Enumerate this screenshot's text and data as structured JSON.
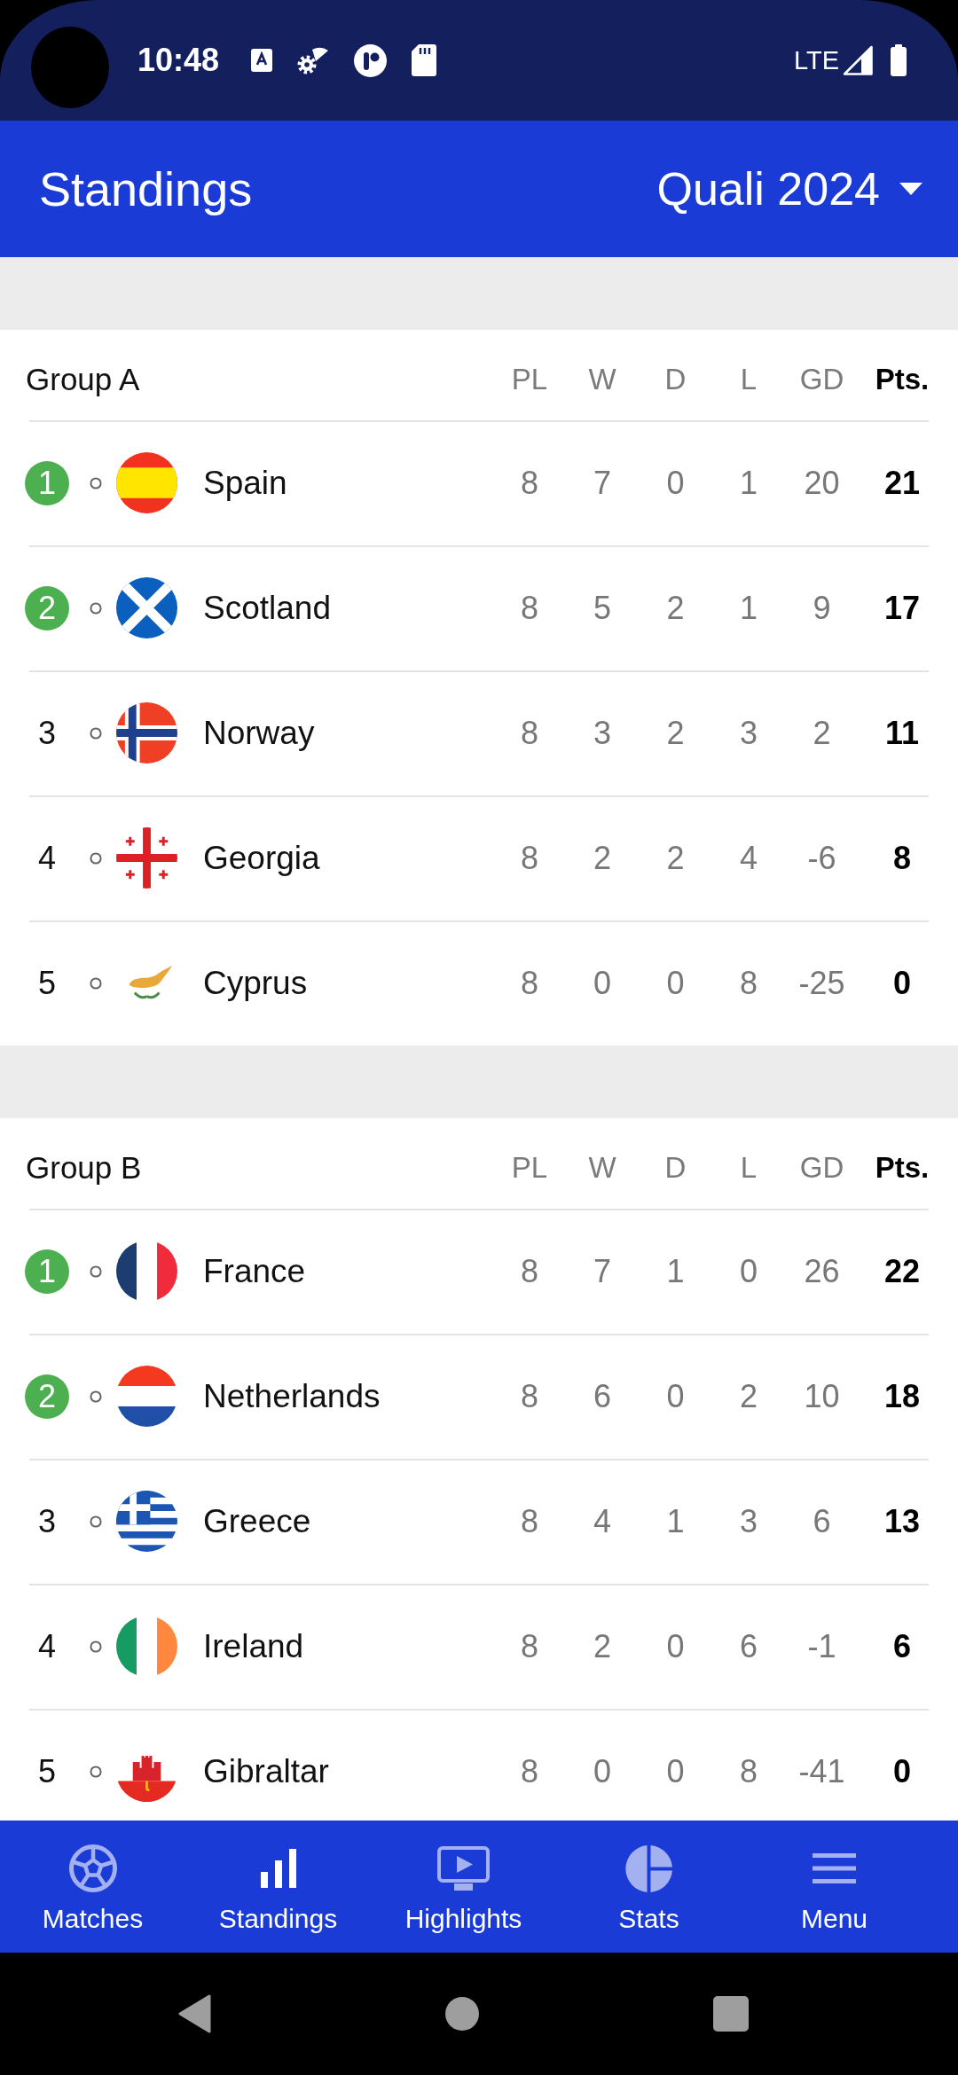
{
  "status_bar": {
    "time": "10:48",
    "network": "LTE"
  },
  "app_bar": {
    "title": "Standings",
    "season": "Quali 2024"
  },
  "groups": [
    {
      "name": "Group A",
      "columns": [
        "PL",
        "W",
        "D",
        "L",
        "GD",
        "Pts."
      ],
      "rows": [
        {
          "rank": "1",
          "qualified": true,
          "team": "Spain",
          "stats": [
            "8",
            "7",
            "0",
            "1",
            "20"
          ],
          "points": "21"
        },
        {
          "rank": "2",
          "qualified": true,
          "team": "Scotland",
          "stats": [
            "8",
            "5",
            "2",
            "1",
            "9"
          ],
          "points": "17"
        },
        {
          "rank": "3",
          "qualified": false,
          "team": "Norway",
          "stats": [
            "8",
            "3",
            "2",
            "3",
            "2"
          ],
          "points": "11"
        },
        {
          "rank": "4",
          "qualified": false,
          "team": "Georgia",
          "stats": [
            "8",
            "2",
            "2",
            "4",
            "-6"
          ],
          "points": "8"
        },
        {
          "rank": "5",
          "qualified": false,
          "team": "Cyprus",
          "stats": [
            "8",
            "0",
            "0",
            "8",
            "-25"
          ],
          "points": "0"
        }
      ]
    },
    {
      "name": "Group B",
      "columns": [
        "PL",
        "W",
        "D",
        "L",
        "GD",
        "Pts."
      ],
      "rows": [
        {
          "rank": "1",
          "qualified": true,
          "team": "France",
          "stats": [
            "8",
            "7",
            "1",
            "0",
            "26"
          ],
          "points": "22"
        },
        {
          "rank": "2",
          "qualified": true,
          "team": "Netherlands",
          "stats": [
            "8",
            "6",
            "0",
            "2",
            "10"
          ],
          "points": "18"
        },
        {
          "rank": "3",
          "qualified": false,
          "team": "Greece",
          "stats": [
            "8",
            "4",
            "1",
            "3",
            "6"
          ],
          "points": "13"
        },
        {
          "rank": "4",
          "qualified": false,
          "team": "Ireland",
          "stats": [
            "8",
            "2",
            "0",
            "6",
            "-1"
          ],
          "points": "6"
        },
        {
          "rank": "5",
          "qualified": false,
          "team": "Gibraltar",
          "stats": [
            "8",
            "0",
            "0",
            "8",
            "-41"
          ],
          "points": "0"
        }
      ]
    }
  ],
  "bottom_nav": [
    {
      "label": "Matches",
      "selected": false
    },
    {
      "label": "Standings",
      "selected": true
    },
    {
      "label": "Highlights",
      "selected": false
    },
    {
      "label": "Stats",
      "selected": false
    },
    {
      "label": "Menu",
      "selected": false
    }
  ]
}
